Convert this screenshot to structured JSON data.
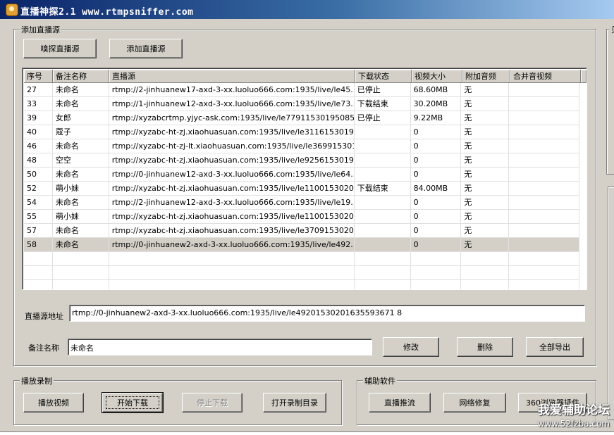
{
  "window": {
    "title": "直播神探2.1 www.rtmpsniffer.com"
  },
  "add_source": {
    "group_label": "添加直播源",
    "sniff_button": "嗅探直播源",
    "add_button": "添加直播源"
  },
  "table": {
    "columns": [
      "序号",
      "备注名称",
      "直播源",
      "下载状态",
      "视频大小",
      "附加音频",
      "合并音视频"
    ],
    "rows": [
      {
        "id": "27",
        "name": "未命名",
        "url": "rtmp://2-jinhuanew17-axd-3-xx.luoluo666.com:1935/live/le45...",
        "status": "已停止",
        "size": "68.60MB",
        "audio": "无",
        "merge": ""
      },
      {
        "id": "33",
        "name": "未命名",
        "url": "rtmp://1-jinhuanew12-axd-3-xx.luoluo666.com:1935/live/le73...",
        "status": "下载结束",
        "size": "30.20MB",
        "audio": "无",
        "merge": ""
      },
      {
        "id": "39",
        "name": "女郎",
        "url": "rtmp://xyzabcrtmp.yjyc-ask.com:1935/live/le779115301950851...",
        "status": "已停止",
        "size": " 9.22MB",
        "audio": "无",
        "merge": ""
      },
      {
        "id": "40",
        "name": "蔻子",
        "url": "rtmp://xyzabc-ht-zj.xiaohuasuan.com:1935/live/le31161530194...",
        "status": "",
        "size": "0",
        "audio": "无",
        "merge": ""
      },
      {
        "id": "46",
        "name": "未命名",
        "url": "rtmp://xyzabc-ht-zj-lt.xiaohuasuan.com:1935/live/le369915301...",
        "status": "",
        "size": "0",
        "audio": "无",
        "merge": ""
      },
      {
        "id": "48",
        "name": "空空",
        "url": "rtmp://xyzabc-ht-zj.xiaohuasuan.com:1935/live/le92561530194...",
        "status": "",
        "size": "0",
        "audio": "无",
        "merge": ""
      },
      {
        "id": "50",
        "name": "未命名",
        "url": "rtmp://0-jinhuanew12-axd-3-xx.luoluo666.com:1935/live/le64...",
        "status": "",
        "size": "0",
        "audio": "无",
        "merge": ""
      },
      {
        "id": "52",
        "name": "萌小妹",
        "url": "rtmp://xyzabc-ht-zj.xiaohuasuan.com:1935/live/le11001530200...",
        "status": "下载结束",
        "size": "84.00MB",
        "audio": "无",
        "merge": ""
      },
      {
        "id": "54",
        "name": "未命名",
        "url": "rtmp://2-jinhuanew12-axd-3-xx.luoluo666.com:1935/live/le19...",
        "status": "",
        "size": "0",
        "audio": "无",
        "merge": ""
      },
      {
        "id": "55",
        "name": "萌小妹",
        "url": "rtmp://xyzabc-ht-zj.xiaohuasuan.com:1935/live/le11001530203...",
        "status": "",
        "size": "0",
        "audio": "无",
        "merge": ""
      },
      {
        "id": "57",
        "name": "未命名",
        "url": "rtmp://xyzabc-ht-zj.xiaohuasuan.com:1935/live/le37091530203...",
        "status": "",
        "size": "0",
        "audio": "无",
        "merge": ""
      },
      {
        "id": "58",
        "name": "未命名",
        "url": "rtmp://0-jinhuanew2-axd-3-xx.luoluo666.com:1935/live/le492...",
        "status": "",
        "size": "0",
        "audio": "无",
        "merge": ""
      }
    ],
    "selected_index": 11,
    "empty_rows": 3
  },
  "source_field": {
    "label": "直播源地址",
    "value": "rtmp://0-jinhuanew2-axd-3-xx.luoluo666.com:1935/live/le49201530201635593671 8"
  },
  "name_field": {
    "label": "备注名称",
    "value": "未命名"
  },
  "actions": {
    "edit": "修改",
    "delete": "删除",
    "export_all": "全部导出"
  },
  "playback": {
    "group_label": "播放录制",
    "play": "播放视频",
    "start": "开始下载",
    "stop": "停止下载",
    "open_dir": "打开录制目录"
  },
  "aux": {
    "group_label": "辅助软件",
    "push": "直播推流",
    "repair": "网络修复",
    "plugin": "360浏览器插件"
  },
  "right_panel": {
    "label": "贝"
  },
  "watermark": {
    "text": "我爱辅助论坛",
    "url": "www.52fzba.com"
  }
}
